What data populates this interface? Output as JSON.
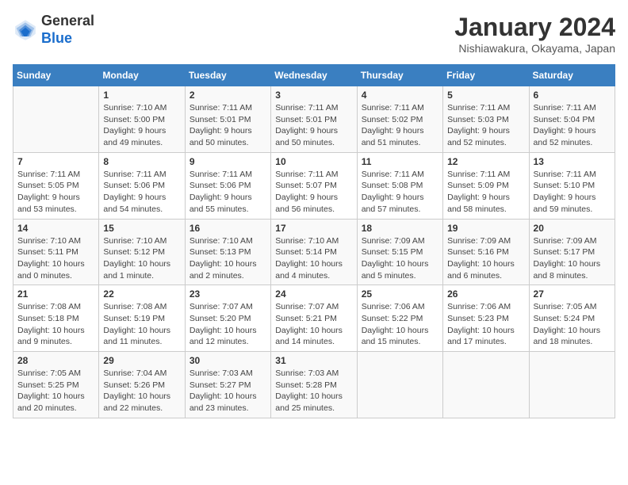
{
  "header": {
    "logo_general": "General",
    "logo_blue": "Blue",
    "month": "January 2024",
    "location": "Nishiawakura, Okayama, Japan"
  },
  "weekdays": [
    "Sunday",
    "Monday",
    "Tuesday",
    "Wednesday",
    "Thursday",
    "Friday",
    "Saturday"
  ],
  "weeks": [
    [
      {
        "day": "",
        "info": ""
      },
      {
        "day": "1",
        "info": "Sunrise: 7:10 AM\nSunset: 5:00 PM\nDaylight: 9 hours\nand 49 minutes."
      },
      {
        "day": "2",
        "info": "Sunrise: 7:11 AM\nSunset: 5:01 PM\nDaylight: 9 hours\nand 50 minutes."
      },
      {
        "day": "3",
        "info": "Sunrise: 7:11 AM\nSunset: 5:01 PM\nDaylight: 9 hours\nand 50 minutes."
      },
      {
        "day": "4",
        "info": "Sunrise: 7:11 AM\nSunset: 5:02 PM\nDaylight: 9 hours\nand 51 minutes."
      },
      {
        "day": "5",
        "info": "Sunrise: 7:11 AM\nSunset: 5:03 PM\nDaylight: 9 hours\nand 52 minutes."
      },
      {
        "day": "6",
        "info": "Sunrise: 7:11 AM\nSunset: 5:04 PM\nDaylight: 9 hours\nand 52 minutes."
      }
    ],
    [
      {
        "day": "7",
        "info": "Sunrise: 7:11 AM\nSunset: 5:05 PM\nDaylight: 9 hours\nand 53 minutes."
      },
      {
        "day": "8",
        "info": "Sunrise: 7:11 AM\nSunset: 5:06 PM\nDaylight: 9 hours\nand 54 minutes."
      },
      {
        "day": "9",
        "info": "Sunrise: 7:11 AM\nSunset: 5:06 PM\nDaylight: 9 hours\nand 55 minutes."
      },
      {
        "day": "10",
        "info": "Sunrise: 7:11 AM\nSunset: 5:07 PM\nDaylight: 9 hours\nand 56 minutes."
      },
      {
        "day": "11",
        "info": "Sunrise: 7:11 AM\nSunset: 5:08 PM\nDaylight: 9 hours\nand 57 minutes."
      },
      {
        "day": "12",
        "info": "Sunrise: 7:11 AM\nSunset: 5:09 PM\nDaylight: 9 hours\nand 58 minutes."
      },
      {
        "day": "13",
        "info": "Sunrise: 7:11 AM\nSunset: 5:10 PM\nDaylight: 9 hours\nand 59 minutes."
      }
    ],
    [
      {
        "day": "14",
        "info": "Sunrise: 7:10 AM\nSunset: 5:11 PM\nDaylight: 10 hours\nand 0 minutes."
      },
      {
        "day": "15",
        "info": "Sunrise: 7:10 AM\nSunset: 5:12 PM\nDaylight: 10 hours\nand 1 minute."
      },
      {
        "day": "16",
        "info": "Sunrise: 7:10 AM\nSunset: 5:13 PM\nDaylight: 10 hours\nand 2 minutes."
      },
      {
        "day": "17",
        "info": "Sunrise: 7:10 AM\nSunset: 5:14 PM\nDaylight: 10 hours\nand 4 minutes."
      },
      {
        "day": "18",
        "info": "Sunrise: 7:09 AM\nSunset: 5:15 PM\nDaylight: 10 hours\nand 5 minutes."
      },
      {
        "day": "19",
        "info": "Sunrise: 7:09 AM\nSunset: 5:16 PM\nDaylight: 10 hours\nand 6 minutes."
      },
      {
        "day": "20",
        "info": "Sunrise: 7:09 AM\nSunset: 5:17 PM\nDaylight: 10 hours\nand 8 minutes."
      }
    ],
    [
      {
        "day": "21",
        "info": "Sunrise: 7:08 AM\nSunset: 5:18 PM\nDaylight: 10 hours\nand 9 minutes."
      },
      {
        "day": "22",
        "info": "Sunrise: 7:08 AM\nSunset: 5:19 PM\nDaylight: 10 hours\nand 11 minutes."
      },
      {
        "day": "23",
        "info": "Sunrise: 7:07 AM\nSunset: 5:20 PM\nDaylight: 10 hours\nand 12 minutes."
      },
      {
        "day": "24",
        "info": "Sunrise: 7:07 AM\nSunset: 5:21 PM\nDaylight: 10 hours\nand 14 minutes."
      },
      {
        "day": "25",
        "info": "Sunrise: 7:06 AM\nSunset: 5:22 PM\nDaylight: 10 hours\nand 15 minutes."
      },
      {
        "day": "26",
        "info": "Sunrise: 7:06 AM\nSunset: 5:23 PM\nDaylight: 10 hours\nand 17 minutes."
      },
      {
        "day": "27",
        "info": "Sunrise: 7:05 AM\nSunset: 5:24 PM\nDaylight: 10 hours\nand 18 minutes."
      }
    ],
    [
      {
        "day": "28",
        "info": "Sunrise: 7:05 AM\nSunset: 5:25 PM\nDaylight: 10 hours\nand 20 minutes."
      },
      {
        "day": "29",
        "info": "Sunrise: 7:04 AM\nSunset: 5:26 PM\nDaylight: 10 hours\nand 22 minutes."
      },
      {
        "day": "30",
        "info": "Sunrise: 7:03 AM\nSunset: 5:27 PM\nDaylight: 10 hours\nand 23 minutes."
      },
      {
        "day": "31",
        "info": "Sunrise: 7:03 AM\nSunset: 5:28 PM\nDaylight: 10 hours\nand 25 minutes."
      },
      {
        "day": "",
        "info": ""
      },
      {
        "day": "",
        "info": ""
      },
      {
        "day": "",
        "info": ""
      }
    ]
  ]
}
